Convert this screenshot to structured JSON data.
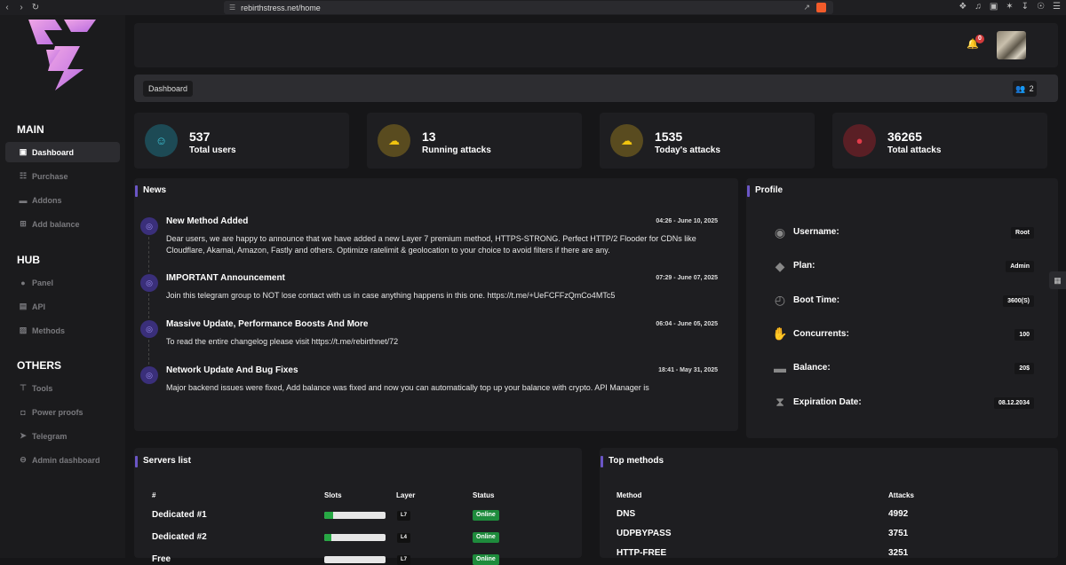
{
  "browser": {
    "url": "rebirthstress.net/home"
  },
  "sidebar": {
    "sections": [
      {
        "title": "MAIN",
        "items": [
          {
            "label": "Dashboard",
            "icon": "dashboard-icon",
            "active": true
          },
          {
            "label": "Purchase",
            "icon": "cart-icon"
          },
          {
            "label": "Addons",
            "icon": "car-icon"
          },
          {
            "label": "Add balance",
            "icon": "plus-square-icon"
          }
        ]
      },
      {
        "title": "HUB",
        "items": [
          {
            "label": "Panel",
            "icon": "bulb-icon"
          },
          {
            "label": "API",
            "icon": "api-icon"
          },
          {
            "label": "Methods",
            "icon": "message-icon"
          }
        ]
      },
      {
        "title": "OTHERS",
        "items": [
          {
            "label": "Tools",
            "icon": "hammer-icon"
          },
          {
            "label": "Power proofs",
            "icon": "lock-icon"
          },
          {
            "label": "Telegram",
            "icon": "telegram-icon"
          },
          {
            "label": "Admin dashboard",
            "icon": "minus-circle-icon"
          }
        ]
      }
    ]
  },
  "header": {
    "notification_count": "0",
    "breadcrumb": "Dashboard",
    "online_users": "2"
  },
  "stats": [
    {
      "value": "537",
      "label": "Total users",
      "icon": "user-icon",
      "bg": "#1d4a55",
      "fg": "#3fc6d9"
    },
    {
      "value": "13",
      "label": "Running attacks",
      "icon": "cloud-icon",
      "bg": "#594b1f",
      "fg": "#f1c40f"
    },
    {
      "value": "1535",
      "label": "Today's attacks",
      "icon": "cloud-icon",
      "bg": "#594b1f",
      "fg": "#f1c40f"
    },
    {
      "value": "36265",
      "label": "Total attacks",
      "icon": "bulb-icon",
      "bg": "#5a1f25",
      "fg": "#e23b4a"
    }
  ],
  "news": {
    "title": "News",
    "items": [
      {
        "heading": "New Method Added",
        "date": "04:26 - June 10, 2025",
        "body": "Dear users, we are happy to announce that we have added a new Layer 7 premium method, HTTPS-STRONG. Perfect HTTP/2 Flooder for CDNs like Cloudflare, Akamai, Amazon, Fastly and others. Optimize ratelimit & geolocation to your choice to avoid filters if there are any."
      },
      {
        "heading": "IMPORTANT Announcement",
        "date": "07:29 - June 07, 2025",
        "body": "Join this telegram group to NOT lose contact with us in case anything happens in this one. https://t.me/+UeFCFFzQmCo4MTc5"
      },
      {
        "heading": "Massive Update, Performance Boosts And More",
        "date": "06:04 - June 05, 2025",
        "body": "To read the entire changelog please visit https://t.me/rebirthnet/72"
      },
      {
        "heading": "Network Update And Bug Fixes",
        "date": "18:41 - May 31, 2025",
        "body": "Major backend issues were fixed, Add balance was fixed and now you can automatically top up your balance with crypto. API Manager is"
      }
    ]
  },
  "profile": {
    "title": "Profile",
    "rows": [
      {
        "label": "Username:",
        "value": "Root",
        "icon": "user-circle-icon"
      },
      {
        "label": "Plan:",
        "value": "Admin",
        "icon": "cube-icon"
      },
      {
        "label": "Boot Time:",
        "value": "3600(S)",
        "icon": "clock-icon"
      },
      {
        "label": "Concurrents:",
        "value": "100",
        "icon": "hand-icon"
      },
      {
        "label": "Balance:",
        "value": "20$",
        "icon": "wallet-icon"
      },
      {
        "label": "Expiration Date:",
        "value": "08.12.2034",
        "icon": "hourglass-icon"
      }
    ]
  },
  "servers": {
    "title": "Servers list",
    "headers": [
      "#",
      "Slots",
      "Layer",
      "Status"
    ],
    "rows": [
      {
        "name": "Dedicated #1",
        "slots_fill": 0.15,
        "layer": "L7",
        "status": "Online"
      },
      {
        "name": "Dedicated #2",
        "slots_fill": 0.12,
        "layer": "L4",
        "status": "Online"
      },
      {
        "name": "Free",
        "slots_fill": 0.0,
        "layer": "L7",
        "status": "Online"
      }
    ]
  },
  "top_methods": {
    "title": "Top methods",
    "headers": [
      "Method",
      "Attacks"
    ],
    "rows": [
      {
        "method": "DNS",
        "attacks": "4992"
      },
      {
        "method": "UDPBYPASS",
        "attacks": "3751"
      },
      {
        "method": "HTTP-FREE",
        "attacks": "3251"
      }
    ]
  }
}
